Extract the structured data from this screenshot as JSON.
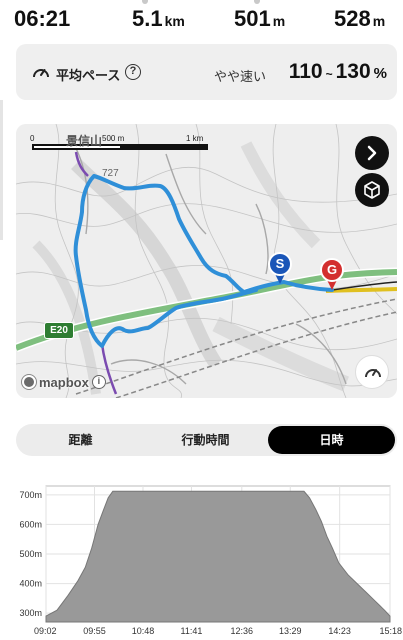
{
  "stats": {
    "time": "06:21",
    "distance_value": "5.1",
    "distance_unit": "km",
    "ascent_value": "501",
    "ascent_unit": "m",
    "descent_value": "528",
    "descent_unit": "m"
  },
  "pace": {
    "label": "平均ペース",
    "help": "?",
    "speed_label": "やや速い",
    "min": "110",
    "tilde": "~",
    "max": "130",
    "unit": "%"
  },
  "map": {
    "scale_zero": "0",
    "scale_500": "500 m",
    "scale_1km": "1 km",
    "place_label": "景信山",
    "peak_label": "727",
    "road_sign": "E20",
    "start_marker": "S",
    "goal_marker": "G",
    "attribution": "mapbox",
    "info": "i",
    "icons": [
      "chevron-right-icon",
      "cube-icon",
      "gauge-icon",
      "mapbox-logo-icon",
      "info-icon"
    ],
    "route_color": "#2f8fd8",
    "start_color": "#1a56b8",
    "goal_color": "#d32f2f"
  },
  "tabs": {
    "items": [
      "距離",
      "行動時間",
      "日時"
    ],
    "selected": "日時"
  },
  "chart_data": {
    "type": "area",
    "y_tick_labels": [
      "300m",
      "400m",
      "500m",
      "600m",
      "700m"
    ],
    "ylim": [
      270,
      730
    ],
    "x_tick_labels": [
      "09:02",
      "09:55",
      "10:48",
      "11:41",
      "12:36",
      "13:29",
      "14:23",
      "15:18"
    ],
    "x_minutes": [
      0,
      53,
      106,
      159,
      214,
      267,
      321,
      376
    ],
    "grid": true,
    "series": [
      {
        "x": [
          0,
          12,
          24,
          35,
          43,
          50,
          57,
          63,
          68,
          73,
          80,
          100,
          150,
          200,
          250,
          276,
          282,
          288,
          295,
          301,
          307,
          313,
          320,
          330,
          340,
          350,
          360,
          370,
          376
        ],
        "y": [
          290,
          310,
          360,
          410,
          455,
          520,
          600,
          650,
          690,
          712,
          712,
          712,
          712,
          712,
          712,
          712,
          712,
          690,
          650,
          610,
          560,
          520,
          470,
          430,
          400,
          370,
          340,
          310,
          290
        ],
        "fill": "#999999",
        "stroke": "#777777"
      }
    ]
  }
}
